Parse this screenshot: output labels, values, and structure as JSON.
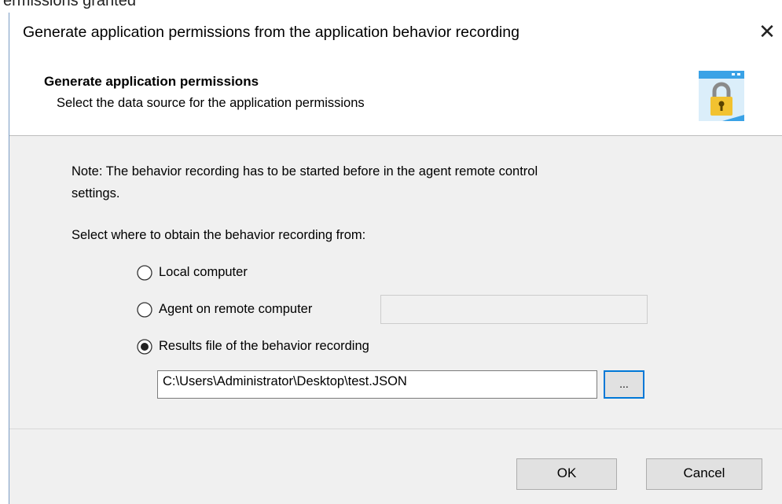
{
  "background_fragment": "ermissions granted",
  "dialog": {
    "title": "Generate application permissions from the application behavior recording",
    "close_glyph": "✕"
  },
  "header": {
    "title": "Generate application permissions",
    "subtitle": "Select the data source for the application permissions"
  },
  "content": {
    "note_line1": "Note: The behavior recording has to be started before in the agent remote control",
    "note_line2": "settings.",
    "select_label": "Select where to obtain the behavior recording from:",
    "options": [
      {
        "label": "Local computer",
        "selected": false
      },
      {
        "label": "Agent on remote computer",
        "selected": false
      },
      {
        "label": "Results file of the behavior recording",
        "selected": true
      }
    ],
    "remote_computer_value": "",
    "file_path": "C:\\Users\\Administrator\\Desktop\\test.JSON",
    "browse_label": "..."
  },
  "buttons": {
    "ok": "OK",
    "cancel": "Cancel"
  },
  "colors": {
    "accent": "#0078d7",
    "lock_gold": "#f2c230",
    "icon_blue": "#3aa2e6"
  }
}
